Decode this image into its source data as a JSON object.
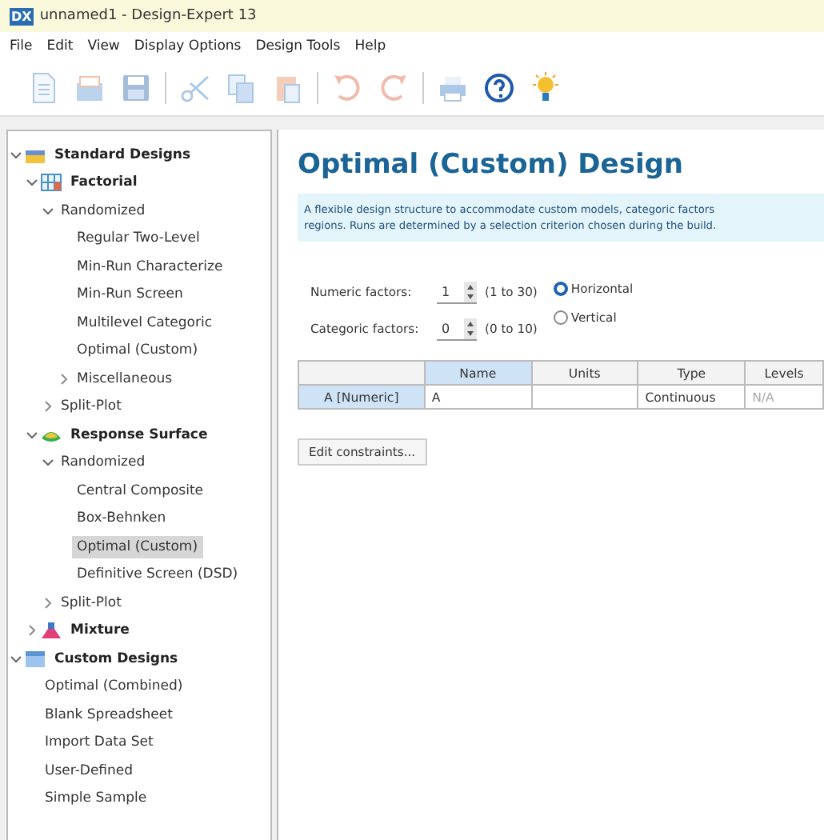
{
  "window": {
    "logo": "DX",
    "title": "unnamed1 - Design-Expert 13"
  },
  "menu": [
    "File",
    "Edit",
    "View",
    "Display Options",
    "Design Tools",
    "Help"
  ],
  "toolbar": [
    {
      "kind": "new",
      "disabled": true
    },
    {
      "kind": "open",
      "disabled": true
    },
    {
      "kind": "save",
      "disabled": true
    },
    {
      "kind": "cut",
      "disabled": true
    },
    {
      "kind": "copy",
      "disabled": true
    },
    {
      "kind": "paste",
      "disabled": true
    },
    {
      "kind": "undo",
      "disabled": true
    },
    {
      "kind": "redo",
      "disabled": true
    },
    {
      "kind": "print",
      "disabled": true
    },
    {
      "kind": "help",
      "disabled": false
    },
    {
      "kind": "tip",
      "disabled": false
    }
  ],
  "sidebar": {
    "tree": [
      {
        "label": "Standard Designs",
        "kind": "category",
        "expanded": true,
        "selected": false,
        "children": [
          {
            "label": "Factorial",
            "kind": "category",
            "expanded": true,
            "selected": false,
            "children": [
              {
                "label": "Randomized",
                "kind": "group",
                "expanded": true,
                "selected": false,
                "children": [
                  {
                    "label": "Regular Two-Level",
                    "kind": "leaf",
                    "selected": false
                  },
                  {
                    "label": "Min-Run Characterize",
                    "kind": "leaf",
                    "selected": false
                  },
                  {
                    "label": "Min-Run Screen",
                    "kind": "leaf",
                    "selected": false
                  },
                  {
                    "label": "Multilevel Categoric",
                    "kind": "leaf",
                    "selected": false
                  },
                  {
                    "label": "Optimal (Custom)",
                    "kind": "leaf",
                    "selected": false
                  },
                  {
                    "label": "Miscellaneous",
                    "kind": "group",
                    "expanded": false,
                    "selected": false
                  }
                ]
              },
              {
                "label": "Split-Plot",
                "kind": "group",
                "expanded": false,
                "selected": false
              }
            ]
          },
          {
            "label": "Response Surface",
            "kind": "category",
            "expanded": true,
            "selected": false,
            "children": [
              {
                "label": "Randomized",
                "kind": "group",
                "expanded": true,
                "selected": false,
                "children": [
                  {
                    "label": "Central Composite",
                    "kind": "leaf",
                    "selected": false
                  },
                  {
                    "label": "Box-Behnken",
                    "kind": "leaf",
                    "selected": false
                  },
                  {
                    "label": "Optimal (Custom)",
                    "kind": "leaf",
                    "selected": true
                  },
                  {
                    "label": "Definitive Screen (DSD)",
                    "kind": "leaf",
                    "selected": false
                  }
                ]
              },
              {
                "label": "Split-Plot",
                "kind": "group",
                "expanded": false,
                "selected": false
              }
            ]
          },
          {
            "label": "Mixture",
            "kind": "category",
            "expanded": false,
            "selected": false
          }
        ]
      },
      {
        "label": "Custom Designs",
        "kind": "category",
        "expanded": true,
        "selected": false,
        "children": [
          {
            "label": "Optimal (Combined)",
            "kind": "leaf",
            "selected": false
          },
          {
            "label": "Blank Spreadsheet",
            "kind": "leaf",
            "selected": false
          },
          {
            "label": "Import Data Set",
            "kind": "leaf",
            "selected": false
          },
          {
            "label": "User-Defined",
            "kind": "leaf",
            "selected": false
          },
          {
            "label": "Simple Sample",
            "kind": "leaf",
            "selected": false
          }
        ]
      }
    ]
  },
  "content": {
    "heading": "Optimal (Custom) Design",
    "info": [
      "A flexible design structure to accommodate custom models, categoric factors",
      "regions. Runs are determined by a selection criterion chosen during the build."
    ],
    "factors": [
      {
        "label": "Numeric factors:",
        "value": "1",
        "range": "(1 to 30)"
      },
      {
        "label": "Categoric factors:",
        "value": "0",
        "range": "(0 to 10)"
      }
    ],
    "layout": [
      {
        "label": "Horizontal",
        "selected": true
      },
      {
        "label": "Vertical",
        "selected": false
      }
    ],
    "table": {
      "columns": [
        {
          "label": "Name",
          "selected": true
        },
        {
          "label": "Units",
          "selected": false
        },
        {
          "label": "Type",
          "selected": false
        },
        {
          "label": "Levels",
          "selected": false
        }
      ],
      "rows": [
        {
          "header": "A [Numeric]",
          "selected": true,
          "cells": [
            {
              "kind": "text",
              "value": "A",
              "disabled": false
            },
            {
              "kind": "blank"
            },
            {
              "kind": "text",
              "value": "Continuous",
              "disabled": false
            },
            {
              "kind": "text",
              "value": "N/A",
              "disabled": true
            }
          ]
        }
      ]
    },
    "button": "Edit constraints..."
  }
}
